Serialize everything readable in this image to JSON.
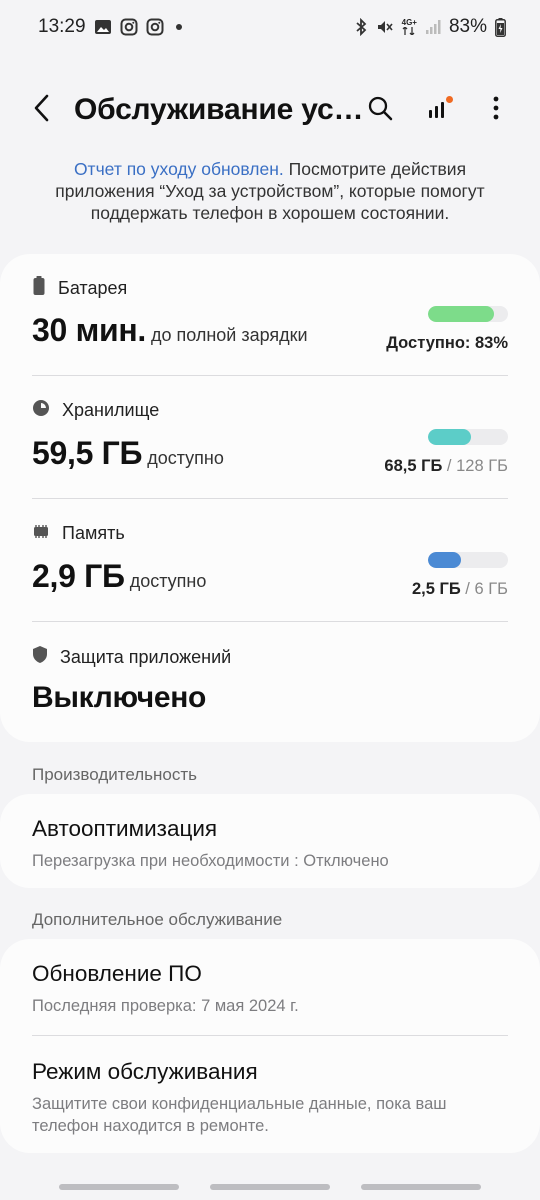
{
  "status_bar": {
    "time": "13:29",
    "battery": "83%",
    "network": "4G+"
  },
  "app_bar": {
    "title": "Обслуживание уст..."
  },
  "report": {
    "link_text": "Отчет по уходу обновлен.",
    "text": " Посмотрите действия приложения “Уход за устройством”, которые помогут поддержать телефон в хорошем состоянии."
  },
  "battery": {
    "label": "Батарея",
    "value": "30 мин.",
    "suffix": "до полной зарядки",
    "right": "Доступно: 83%",
    "level": 0.83,
    "color": "#7ddc8a"
  },
  "storage": {
    "label": "Хранилище",
    "value": "59,5 ГБ",
    "suffix": "доступно",
    "used": "68,5 ГБ",
    "separator": " / ",
    "total": "128 ГБ",
    "level": 0.535,
    "color": "#5ccdc8"
  },
  "memory": {
    "label": "Память",
    "value": "2,9 ГБ",
    "suffix": "доступно",
    "used": "2,5 ГБ",
    "separator": " / ",
    "total": "6 ГБ",
    "level": 0.417,
    "color": "#4b8ad4"
  },
  "app_protection": {
    "label": "Защита приложений",
    "value": "Выключено"
  },
  "performance": {
    "header": "Производительность",
    "item_title": "Автооптимизация",
    "item_sub": "Перезагрузка при необходимости : Отключено"
  },
  "additional": {
    "header": "Дополнительное обслуживание",
    "update_title": "Обновление ПО",
    "update_sub": "Последняя проверка: 7 мая 2024 г.",
    "maintenance_title": "Режим обслуживания",
    "maintenance_sub": "Защитите свои конфиденциальные данные, пока ваш телефон находится в ремонте."
  },
  "icons": {
    "back": "back-arrow-icon",
    "search": "search-icon",
    "diagnostics": "signal-bars-icon",
    "more": "more-vert-icon"
  }
}
